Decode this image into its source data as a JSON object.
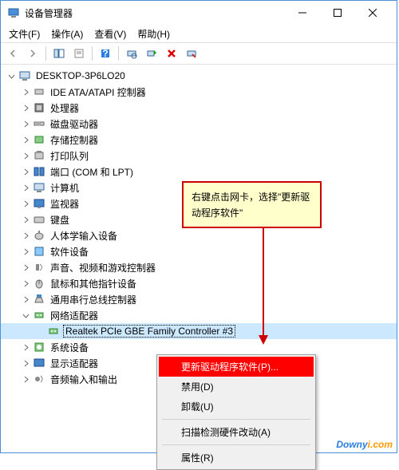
{
  "window": {
    "title": "设备管理器"
  },
  "menu": {
    "file": "文件(F)",
    "action": "操作(A)",
    "view": "查看(V)",
    "help": "帮助(H)"
  },
  "tree": {
    "root": "DESKTOP-3P6LO20",
    "items": [
      "IDE ATA/ATAPI 控制器",
      "处理器",
      "磁盘驱动器",
      "存储控制器",
      "打印队列",
      "端口 (COM 和 LPT)",
      "计算机",
      "监视器",
      "键盘",
      "人体学输入设备",
      "软件设备",
      "声音、视频和游戏控制器",
      "鼠标和其他指针设备",
      "通用串行总线控制器",
      "网络适配器",
      "系统设备",
      "显示适配器",
      "音频输入和输出"
    ],
    "selected": "Realtek PCIe GBE Family Controller #3"
  },
  "context": {
    "update": "更新驱动程序软件(P)...",
    "disable": "禁用(D)",
    "uninstall": "卸载(U)",
    "scan": "扫描检测硬件改动(A)",
    "properties": "属性(R)"
  },
  "callout": "右键点击网卡，选择\"更新驱动程序软件\"",
  "watermark": {
    "p1": "Downy",
    "p2": "i.com"
  }
}
